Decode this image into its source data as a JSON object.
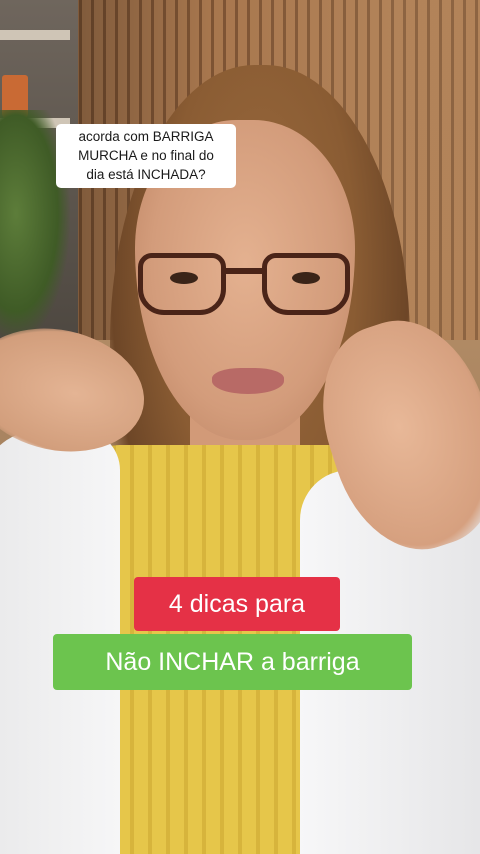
{
  "question_box": {
    "line1": "acorda com BARRIGA",
    "line2": "MURCHA e no final do",
    "line3": "dia está INCHADA?"
  },
  "captions": {
    "title": "4 dicas para",
    "subtitle": "Não INCHAR a barriga"
  },
  "colors": {
    "title_bg": "#e53146",
    "subtitle_bg": "#6cc44e",
    "question_bg": "#ffffff"
  }
}
